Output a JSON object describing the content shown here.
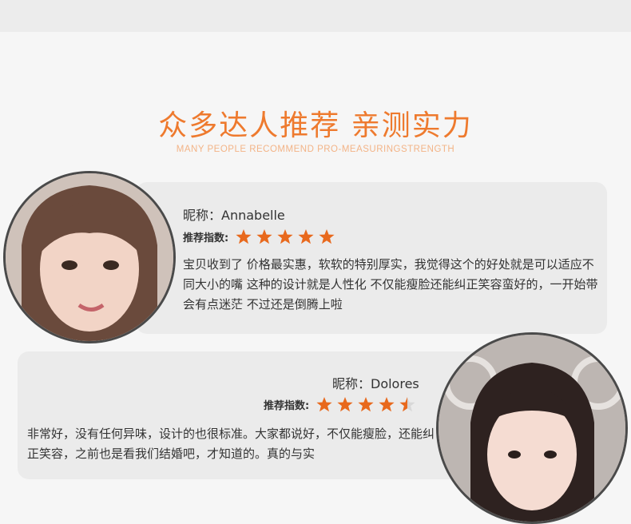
{
  "section": {
    "title": "众多达人推荐 亲测实力",
    "subtitle": "MANY PEOPLE RECOMMEND PRO-MEASURINGSTRENGTH"
  },
  "reviews": [
    {
      "nickname": "昵称：Annabelle",
      "rating_label": "推荐指数:",
      "rating": 5,
      "text": "宝贝收到了 价格最实惠，软软的特别厚实，我觉得这个的好处就是可以适应不同大小的嘴 这种的设计就是人性化 不仅能瘦脸还能纠正笑容蛮好的，一开始带会有点迷茫 不过还是倒腾上啦"
    },
    {
      "nickname": "昵称：Dolores",
      "rating_label": "推荐指数:",
      "rating": 4.5,
      "text": "非常好，没有任何异味，设计的也很标准。大家都说好，不仅能瘦脸，还能纠正笑容，之前也是看我们结婚吧，才知道的。真的与实"
    }
  ],
  "colors": {
    "accent": "#ee7a2e",
    "star": "#e8691d",
    "card_bg": "#ebebeb"
  }
}
